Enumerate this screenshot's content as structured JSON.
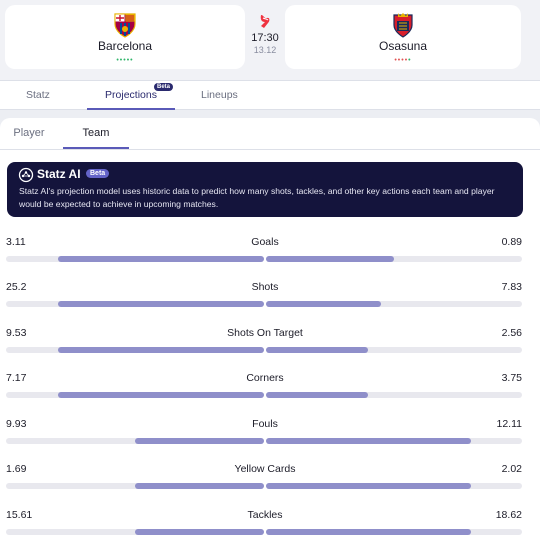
{
  "match": {
    "home": {
      "name": "Barcelona",
      "form": "•••••",
      "form_color": "#2fb56a"
    },
    "away": {
      "name": "Osasuna",
      "form": "•••••",
      "form_color": "#e05353"
    },
    "time": "17:30",
    "date": "13.12"
  },
  "tabs": [
    {
      "label": "Statz"
    },
    {
      "label": "Projections",
      "badge": "Beta",
      "active": true
    },
    {
      "label": "Lineups"
    }
  ],
  "subtabs": [
    {
      "label": "Player"
    },
    {
      "label": "Team",
      "active": true
    }
  ],
  "ai": {
    "title": "Statz AI",
    "badge": "Beta",
    "description": "Statz AI's projection model uses historic data to predict how many shots, tackles, and other key actions each team and player would be expected to achieve in upcoming matches."
  },
  "stats": [
    {
      "label": "Goals",
      "home": "3.11",
      "away": "0.89",
      "home_share": 0.8,
      "away_share": 0.5
    },
    {
      "label": "Shots",
      "home": "25.2",
      "away": "7.83",
      "home_share": 0.8,
      "away_share": 0.45
    },
    {
      "label": "Shots On Target",
      "home": "9.53",
      "away": "2.56",
      "home_share": 0.8,
      "away_share": 0.4
    },
    {
      "label": "Corners",
      "home": "7.17",
      "away": "3.75",
      "home_share": 0.8,
      "away_share": 0.4
    },
    {
      "label": "Fouls",
      "home": "9.93",
      "away": "12.11",
      "home_share": 0.5,
      "away_share": 0.8
    },
    {
      "label": "Yellow Cards",
      "home": "1.69",
      "away": "2.02",
      "home_share": 0.5,
      "away_share": 0.8
    },
    {
      "label": "Tackles",
      "home": "15.61",
      "away": "18.62",
      "home_share": 0.5,
      "away_share": 0.8
    }
  ],
  "colors": {
    "accent": "#5a5ab8",
    "bar_fill": "#8f8fca",
    "ai_bg": "#14143c"
  }
}
